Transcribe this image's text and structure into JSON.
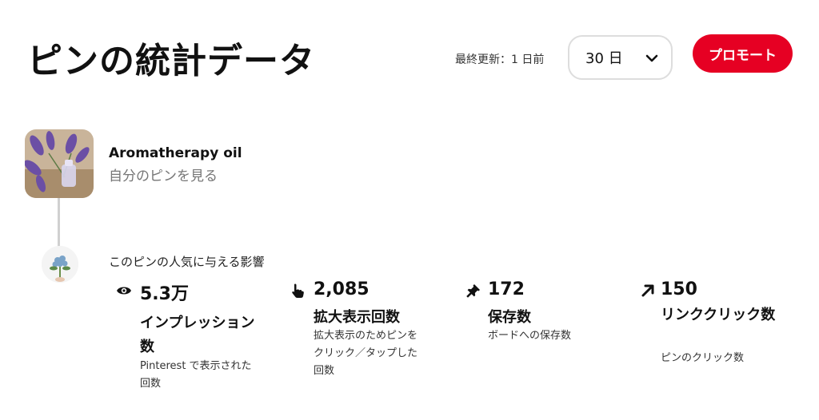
{
  "header": {
    "title": "ピンの統計データ",
    "last_updated": "最終更新：1 日前",
    "date_range": "30 日",
    "promote_label": "プロモート"
  },
  "pin": {
    "title": "Aromatherapy oil",
    "view_link": "自分のピンを見る",
    "influence_label": "このピンの人気に与える影響"
  },
  "metrics": [
    {
      "icon": "eye-icon",
      "value": "5.3万",
      "name": "インプレッション数",
      "desc": "Pinterest で表示された回数"
    },
    {
      "icon": "hand-pointer-icon",
      "value": "2,085",
      "name": "拡大表示回数",
      "desc": "拡大表示のためピンをクリック／タップした回数"
    },
    {
      "icon": "pushpin-icon",
      "value": "172",
      "name": "保存数",
      "desc": "ボードへの保存数"
    },
    {
      "icon": "arrow-up-right-icon",
      "value": "150",
      "name": "リンククリック数",
      "desc": "ピンのクリック数"
    }
  ],
  "colors": {
    "accent": "#e60023",
    "muted_text": "#767676",
    "border": "#dddddd"
  }
}
